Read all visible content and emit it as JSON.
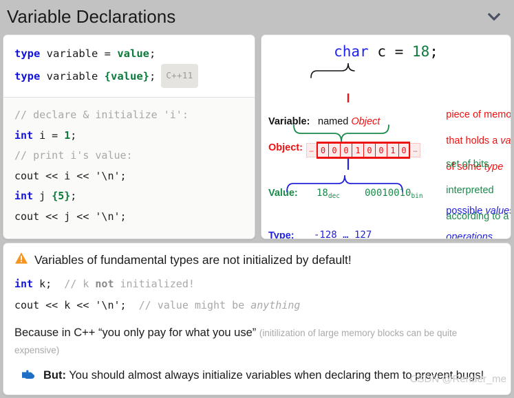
{
  "header": {
    "title": "Variable Declarations",
    "collapse_icon": "chevron-down-icon"
  },
  "syntax_panel": {
    "line1": {
      "kw": "type",
      "name": " variable ",
      "eq": "= ",
      "val": "value",
      "end": ";"
    },
    "line2": {
      "kw": "type",
      "name": " variable ",
      "brace_open": "{",
      "val": "value",
      "brace_close": "}",
      "end": ";"
    },
    "badge": "C++11"
  },
  "example_panel": {
    "lines": [
      {
        "comment": "// declare & initialize 'i':"
      },
      {
        "kw": "int",
        "rest": " i = ",
        "lit": "1",
        "end": ";"
      },
      {
        "comment": "// print i's value:"
      },
      {
        "plain": "cout << i << '\\n';"
      },
      {
        "kw": "int",
        "rest": " j ",
        "brace_open": "{",
        "lit": "5",
        "brace_close": "}",
        "end": ";"
      },
      {
        "plain": "cout << j << '\\n';"
      }
    ]
  },
  "diagram": {
    "declaration": {
      "type": "char",
      "name": " c ",
      "eq": "= ",
      "value": "18",
      "semi": ";"
    },
    "rows": [
      {
        "label": "Variable:",
        "color": "#ee1111"
      },
      {
        "label": "Object:",
        "color": "#ee1111"
      },
      {
        "label": "Value:",
        "color": "#1a8a4a"
      },
      {
        "label": "Type:",
        "color": "#2222dd"
      }
    ],
    "variable_label_black": "Variable:",
    "variable_text_plain": "named ",
    "variable_text_em": "Object",
    "object_label": "Object:",
    "bits": [
      "0",
      "0",
      "0",
      "1",
      "0",
      "0",
      "1",
      "0"
    ],
    "bits_ellipsis": "…",
    "value_label": "Value:",
    "value_dec": "18",
    "value_dec_sub": "dec",
    "value_arrow": "⟵",
    "value_bin": "00010010",
    "value_bin_sub": "bin",
    "type_label": "Type:",
    "type_range": "-128 … 127",
    "type_ops": "+ * - / %",
    "note_object": [
      "piece of memory",
      "that holds a ",
      "value",
      "of some ",
      "type"
    ],
    "note_object_l1": "piece of memory",
    "note_object_l2a": "that holds a ",
    "note_object_l2b": "value",
    "note_object_l3a": "of some ",
    "note_object_l3b": "type",
    "note_value_l1": "set of bits",
    "note_value_l2": "interpreted",
    "note_value_l3a": "according to a ",
    "note_value_l3b": "type",
    "note_type_l1a": "possible ",
    "note_type_l1b": "values",
    "note_type_l1c": " &",
    "note_type_l2": "operations",
    "colors": {
      "red": "#ee1111",
      "green": "#1a8a4a",
      "blue": "#2222dd",
      "bit_fill": "#fdeaea"
    }
  },
  "warning_panel": {
    "icon": "warning-triangle-icon",
    "heading": "Variables of fundamental types are not initialized by default!",
    "code": [
      {
        "kw": "int",
        "rest": " k;  ",
        "cmt_a": "// k ",
        "cmt_bold": "not",
        "cmt_b": " initialized!"
      },
      {
        "plain": "cout << k << '\\n';  ",
        "cmt_a": "// value might be ",
        "cmt_italic": "anything"
      }
    ],
    "prose_main": "Because in C++ “you only pay for what you use” ",
    "prose_note": "(initilization of large memory blocks can be quite expensive)",
    "but_icon": "pointing-hand-icon",
    "but_bold": "But:",
    "but_rest": " You should almost always initialize variables when declaring them to prevent bugs!"
  },
  "watermark": "CSDN @Render_me"
}
